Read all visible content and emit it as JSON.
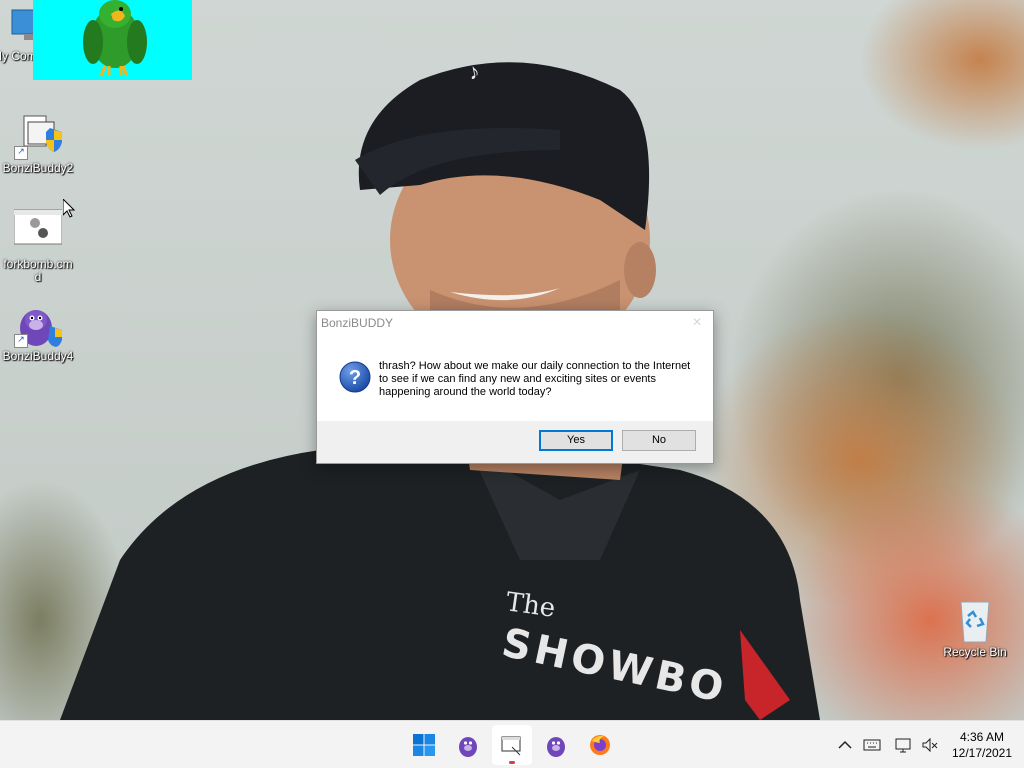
{
  "desktop": {
    "icons": [
      {
        "label": "My Computer",
        "icon": "computer-icon"
      },
      {
        "label": "BonziBuddy2",
        "icon": "bonzi-installer-icon"
      },
      {
        "label": "forkbomb.cmd",
        "icon": "cmd-script-icon"
      },
      {
        "label": "BonziBuddy4",
        "icon": "bonzi-gorilla-icon"
      },
      {
        "label": "Recycle Bin",
        "icon": "recycle-bin-icon"
      }
    ],
    "wallpaper_text": "The SHOWBO"
  },
  "dialog": {
    "title": "BonziBUDDY",
    "icon": "question-icon",
    "message": "thrash?  How about we make our daily connection to the Internet to see if we can find any new and exciting sites or events happening around the world today?",
    "yes_label": "Yes",
    "no_label": "No"
  },
  "taskbar": {
    "apps": [
      {
        "name": "start",
        "icon": "windows-start-icon"
      },
      {
        "name": "bonzibuddy",
        "icon": "bonzi-gorilla-icon"
      },
      {
        "name": "explorer-window",
        "icon": "window-frame-icon",
        "active": true
      },
      {
        "name": "bonzibuddy-2",
        "icon": "bonzi-gorilla-icon"
      },
      {
        "name": "firefox",
        "icon": "firefox-icon"
      }
    ],
    "tray": [
      "chevron-up-icon",
      "keyboard-icon",
      "network-icon",
      "volume-muted-icon"
    ],
    "time": "4:36 AM",
    "date": "12/17/2021"
  },
  "colors": {
    "agent_background": "#00ffff",
    "accent": "#0078d7",
    "question_blue": "#1e4fa8"
  }
}
